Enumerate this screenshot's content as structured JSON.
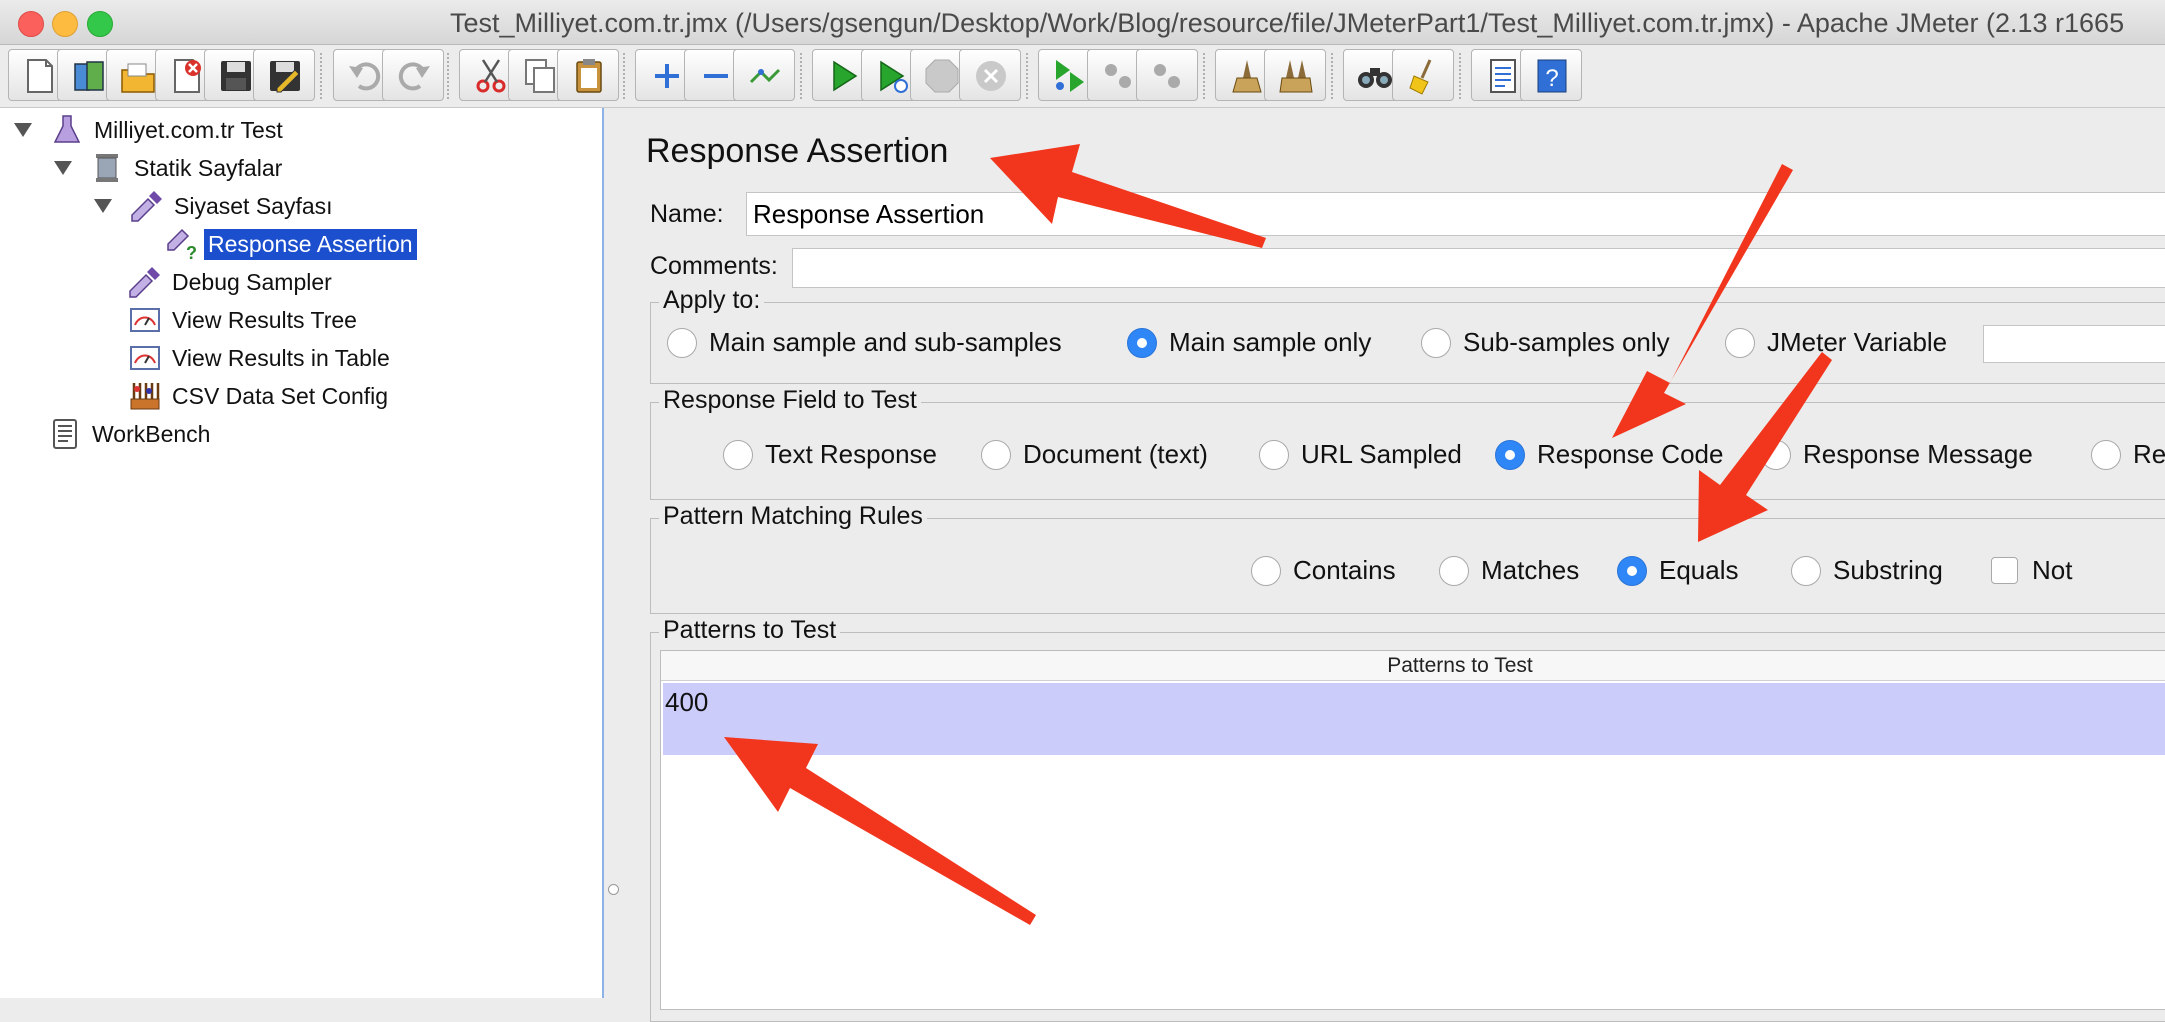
{
  "window": {
    "title": "Test_Milliyet.com.tr.jmx (/Users/gsengun/Desktop/Work/Blog/resource/file/JMeterPart1/Test_Milliyet.com.tr.jmx) - Apache JMeter (2.13 r1665"
  },
  "toolbar": {
    "buttons": [
      {
        "name": "new-icon"
      },
      {
        "name": "templates-icon"
      },
      {
        "name": "open-icon"
      },
      {
        "name": "close-icon"
      },
      {
        "name": "save-icon"
      },
      {
        "name": "save-as-icon"
      },
      {
        "name": "undo-icon"
      },
      {
        "name": "redo-icon"
      },
      {
        "name": "cut-icon"
      },
      {
        "name": "copy-icon"
      },
      {
        "name": "paste-icon"
      },
      {
        "name": "expand-icon"
      },
      {
        "name": "collapse-icon"
      },
      {
        "name": "toggle-icon"
      },
      {
        "name": "start-icon"
      },
      {
        "name": "start-no-pause-icon"
      },
      {
        "name": "stop-icon"
      },
      {
        "name": "shutdown-icon"
      },
      {
        "name": "remote-start-icon"
      },
      {
        "name": "remote-stop-icon"
      },
      {
        "name": "remote-shutdown-icon"
      },
      {
        "name": "clear-icon"
      },
      {
        "name": "clear-all-icon"
      },
      {
        "name": "search-icon"
      },
      {
        "name": "reset-search-icon"
      },
      {
        "name": "function-helper-icon"
      },
      {
        "name": "help-icon"
      }
    ]
  },
  "tree": {
    "items": [
      {
        "label": "Milliyet.com.tr Test",
        "icon": "test-plan-icon"
      },
      {
        "label": "Statik Sayfalar",
        "icon": "thread-group-icon"
      },
      {
        "label": "Siyaset Sayfası",
        "icon": "sampler-icon"
      },
      {
        "label": "Response Assertion",
        "icon": "assertion-icon"
      },
      {
        "label": "Debug Sampler",
        "icon": "sampler-icon"
      },
      {
        "label": "View Results Tree",
        "icon": "listener-icon"
      },
      {
        "label": "View Results in Table",
        "icon": "listener-icon"
      },
      {
        "label": "CSV Data Set Config",
        "icon": "config-icon"
      },
      {
        "label": "WorkBench",
        "icon": "workbench-icon"
      }
    ]
  },
  "panel": {
    "title": "Response Assertion",
    "name_label": "Name:",
    "name_value": "Response Assertion",
    "comments_label": "Comments:",
    "apply_to": {
      "title": "Apply to:",
      "options": [
        "Main sample and sub-samples",
        "Main sample only",
        "Sub-samples only",
        "JMeter Variable"
      ],
      "selected": "Main sample only"
    },
    "response_field": {
      "title": "Response Field to Test",
      "options": [
        "Text Response",
        "Document (text)",
        "URL Sampled",
        "Response Code",
        "Response Message",
        "Resp"
      ],
      "selected": "Response Code"
    },
    "pattern_rules": {
      "title": "Pattern Matching Rules",
      "options": [
        "Contains",
        "Matches",
        "Equals",
        "Substring"
      ],
      "selected": "Equals",
      "not_label": "Not",
      "not_checked": false
    },
    "patterns": {
      "title": "Patterns to Test",
      "column_header": "Patterns to Test",
      "rows": [
        "400"
      ]
    }
  },
  "colors": {
    "accent": "#2f86f6",
    "selection": "#1c4fce",
    "table_row": "#ccccfb",
    "annotation_arrow": "#f1361d"
  }
}
